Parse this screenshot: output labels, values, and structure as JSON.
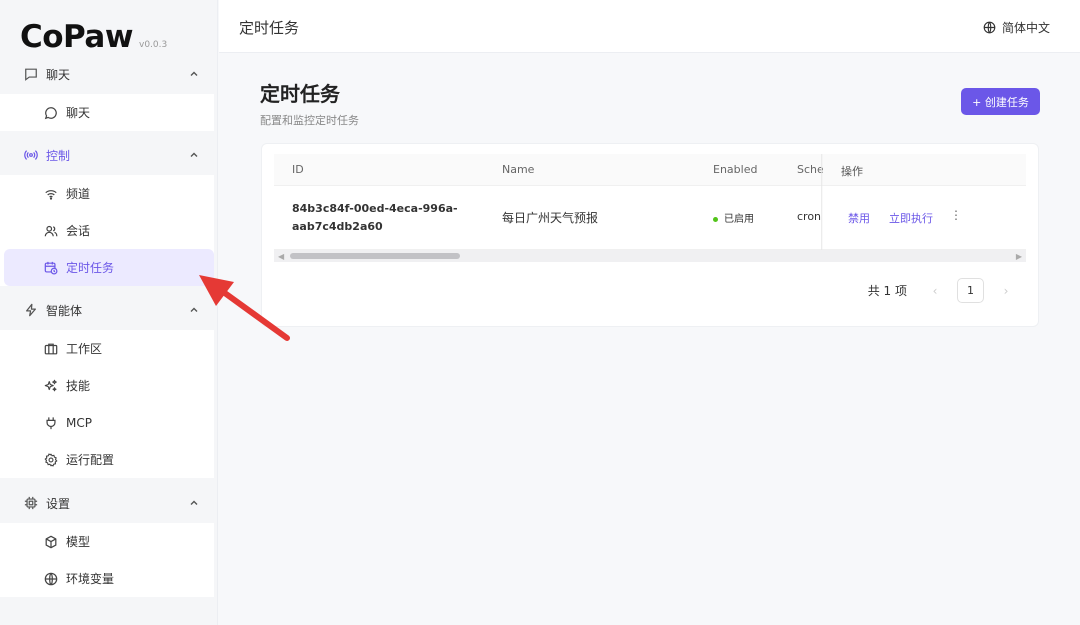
{
  "brand": {
    "logo": "CoPaw",
    "version": "v0.0.3"
  },
  "topbar": {
    "title": "定时任务",
    "language": "简体中文"
  },
  "sidebar": {
    "groups": [
      {
        "label": "聊天",
        "items": [
          {
            "label": "聊天",
            "icon": "chat-bubble-icon"
          }
        ]
      },
      {
        "label": "控制",
        "items": [
          {
            "label": "频道",
            "icon": "wifi-icon"
          },
          {
            "label": "会话",
            "icon": "users-icon"
          },
          {
            "label": "定时任务",
            "icon": "calendar-clock-icon",
            "selected": true
          }
        ]
      },
      {
        "label": "智能体",
        "items": [
          {
            "label": "工作区",
            "icon": "briefcase-icon"
          },
          {
            "label": "技能",
            "icon": "sparkles-icon"
          },
          {
            "label": "MCP",
            "icon": "plug-icon"
          },
          {
            "label": "运行配置",
            "icon": "gear-icon"
          }
        ]
      },
      {
        "label": "设置",
        "items": [
          {
            "label": "模型",
            "icon": "cube-icon"
          },
          {
            "label": "环境变量",
            "icon": "globe-icon"
          }
        ]
      }
    ]
  },
  "main": {
    "title": "定时任务",
    "subtitle": "配置和监控定时任务",
    "create_button": "+ 创建任务",
    "table": {
      "columns": {
        "id": "ID",
        "name": "Name",
        "enabled": "Enabled",
        "schedule": "Schec",
        "actions": "操作"
      },
      "rows": [
        {
          "id_line1": "84b3c84f-00ed-4eca-996a-",
          "id_line2": "aab7c4db2a60",
          "name": "每日广州天气预报",
          "enabled": "已启用",
          "schedule": "cron",
          "action_disable": "禁用",
          "action_run": "立即执行",
          "action_more": "⋮"
        }
      ]
    },
    "pagination": {
      "total": "共 1 项",
      "current_page": "1",
      "prev": "‹",
      "next": "›"
    }
  },
  "colors": {
    "accent": "#6b57e8",
    "enabled": "#52c41a",
    "annotation": "#e53935"
  }
}
